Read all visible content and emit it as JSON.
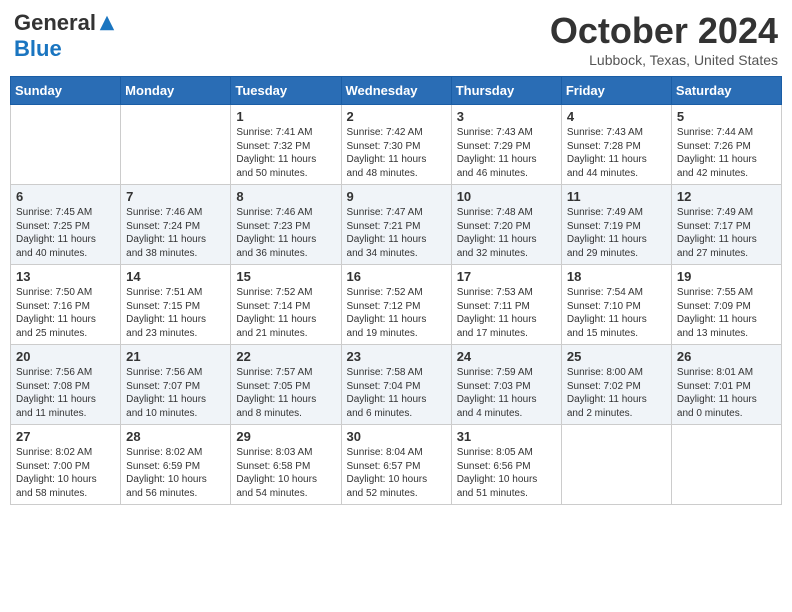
{
  "header": {
    "logo_general": "General",
    "logo_blue": "Blue",
    "month_title": "October 2024",
    "location": "Lubbock, Texas, United States"
  },
  "weekdays": [
    "Sunday",
    "Monday",
    "Tuesday",
    "Wednesday",
    "Thursday",
    "Friday",
    "Saturday"
  ],
  "weeks": [
    [
      {
        "day": "",
        "sunrise": "",
        "sunset": "",
        "daylight": ""
      },
      {
        "day": "",
        "sunrise": "",
        "sunset": "",
        "daylight": ""
      },
      {
        "day": "1",
        "sunrise": "Sunrise: 7:41 AM",
        "sunset": "Sunset: 7:32 PM",
        "daylight": "Daylight: 11 hours and 50 minutes."
      },
      {
        "day": "2",
        "sunrise": "Sunrise: 7:42 AM",
        "sunset": "Sunset: 7:30 PM",
        "daylight": "Daylight: 11 hours and 48 minutes."
      },
      {
        "day": "3",
        "sunrise": "Sunrise: 7:43 AM",
        "sunset": "Sunset: 7:29 PM",
        "daylight": "Daylight: 11 hours and 46 minutes."
      },
      {
        "day": "4",
        "sunrise": "Sunrise: 7:43 AM",
        "sunset": "Sunset: 7:28 PM",
        "daylight": "Daylight: 11 hours and 44 minutes."
      },
      {
        "day": "5",
        "sunrise": "Sunrise: 7:44 AM",
        "sunset": "Sunset: 7:26 PM",
        "daylight": "Daylight: 11 hours and 42 minutes."
      }
    ],
    [
      {
        "day": "6",
        "sunrise": "Sunrise: 7:45 AM",
        "sunset": "Sunset: 7:25 PM",
        "daylight": "Daylight: 11 hours and 40 minutes."
      },
      {
        "day": "7",
        "sunrise": "Sunrise: 7:46 AM",
        "sunset": "Sunset: 7:24 PM",
        "daylight": "Daylight: 11 hours and 38 minutes."
      },
      {
        "day": "8",
        "sunrise": "Sunrise: 7:46 AM",
        "sunset": "Sunset: 7:23 PM",
        "daylight": "Daylight: 11 hours and 36 minutes."
      },
      {
        "day": "9",
        "sunrise": "Sunrise: 7:47 AM",
        "sunset": "Sunset: 7:21 PM",
        "daylight": "Daylight: 11 hours and 34 minutes."
      },
      {
        "day": "10",
        "sunrise": "Sunrise: 7:48 AM",
        "sunset": "Sunset: 7:20 PM",
        "daylight": "Daylight: 11 hours and 32 minutes."
      },
      {
        "day": "11",
        "sunrise": "Sunrise: 7:49 AM",
        "sunset": "Sunset: 7:19 PM",
        "daylight": "Daylight: 11 hours and 29 minutes."
      },
      {
        "day": "12",
        "sunrise": "Sunrise: 7:49 AM",
        "sunset": "Sunset: 7:17 PM",
        "daylight": "Daylight: 11 hours and 27 minutes."
      }
    ],
    [
      {
        "day": "13",
        "sunrise": "Sunrise: 7:50 AM",
        "sunset": "Sunset: 7:16 PM",
        "daylight": "Daylight: 11 hours and 25 minutes."
      },
      {
        "day": "14",
        "sunrise": "Sunrise: 7:51 AM",
        "sunset": "Sunset: 7:15 PM",
        "daylight": "Daylight: 11 hours and 23 minutes."
      },
      {
        "day": "15",
        "sunrise": "Sunrise: 7:52 AM",
        "sunset": "Sunset: 7:14 PM",
        "daylight": "Daylight: 11 hours and 21 minutes."
      },
      {
        "day": "16",
        "sunrise": "Sunrise: 7:52 AM",
        "sunset": "Sunset: 7:12 PM",
        "daylight": "Daylight: 11 hours and 19 minutes."
      },
      {
        "day": "17",
        "sunrise": "Sunrise: 7:53 AM",
        "sunset": "Sunset: 7:11 PM",
        "daylight": "Daylight: 11 hours and 17 minutes."
      },
      {
        "day": "18",
        "sunrise": "Sunrise: 7:54 AM",
        "sunset": "Sunset: 7:10 PM",
        "daylight": "Daylight: 11 hours and 15 minutes."
      },
      {
        "day": "19",
        "sunrise": "Sunrise: 7:55 AM",
        "sunset": "Sunset: 7:09 PM",
        "daylight": "Daylight: 11 hours and 13 minutes."
      }
    ],
    [
      {
        "day": "20",
        "sunrise": "Sunrise: 7:56 AM",
        "sunset": "Sunset: 7:08 PM",
        "daylight": "Daylight: 11 hours and 11 minutes."
      },
      {
        "day": "21",
        "sunrise": "Sunrise: 7:56 AM",
        "sunset": "Sunset: 7:07 PM",
        "daylight": "Daylight: 11 hours and 10 minutes."
      },
      {
        "day": "22",
        "sunrise": "Sunrise: 7:57 AM",
        "sunset": "Sunset: 7:05 PM",
        "daylight": "Daylight: 11 hours and 8 minutes."
      },
      {
        "day": "23",
        "sunrise": "Sunrise: 7:58 AM",
        "sunset": "Sunset: 7:04 PM",
        "daylight": "Daylight: 11 hours and 6 minutes."
      },
      {
        "day": "24",
        "sunrise": "Sunrise: 7:59 AM",
        "sunset": "Sunset: 7:03 PM",
        "daylight": "Daylight: 11 hours and 4 minutes."
      },
      {
        "day": "25",
        "sunrise": "Sunrise: 8:00 AM",
        "sunset": "Sunset: 7:02 PM",
        "daylight": "Daylight: 11 hours and 2 minutes."
      },
      {
        "day": "26",
        "sunrise": "Sunrise: 8:01 AM",
        "sunset": "Sunset: 7:01 PM",
        "daylight": "Daylight: 11 hours and 0 minutes."
      }
    ],
    [
      {
        "day": "27",
        "sunrise": "Sunrise: 8:02 AM",
        "sunset": "Sunset: 7:00 PM",
        "daylight": "Daylight: 10 hours and 58 minutes."
      },
      {
        "day": "28",
        "sunrise": "Sunrise: 8:02 AM",
        "sunset": "Sunset: 6:59 PM",
        "daylight": "Daylight: 10 hours and 56 minutes."
      },
      {
        "day": "29",
        "sunrise": "Sunrise: 8:03 AM",
        "sunset": "Sunset: 6:58 PM",
        "daylight": "Daylight: 10 hours and 54 minutes."
      },
      {
        "day": "30",
        "sunrise": "Sunrise: 8:04 AM",
        "sunset": "Sunset: 6:57 PM",
        "daylight": "Daylight: 10 hours and 52 minutes."
      },
      {
        "day": "31",
        "sunrise": "Sunrise: 8:05 AM",
        "sunset": "Sunset: 6:56 PM",
        "daylight": "Daylight: 10 hours and 51 minutes."
      },
      {
        "day": "",
        "sunrise": "",
        "sunset": "",
        "daylight": ""
      },
      {
        "day": "",
        "sunrise": "",
        "sunset": "",
        "daylight": ""
      }
    ]
  ]
}
